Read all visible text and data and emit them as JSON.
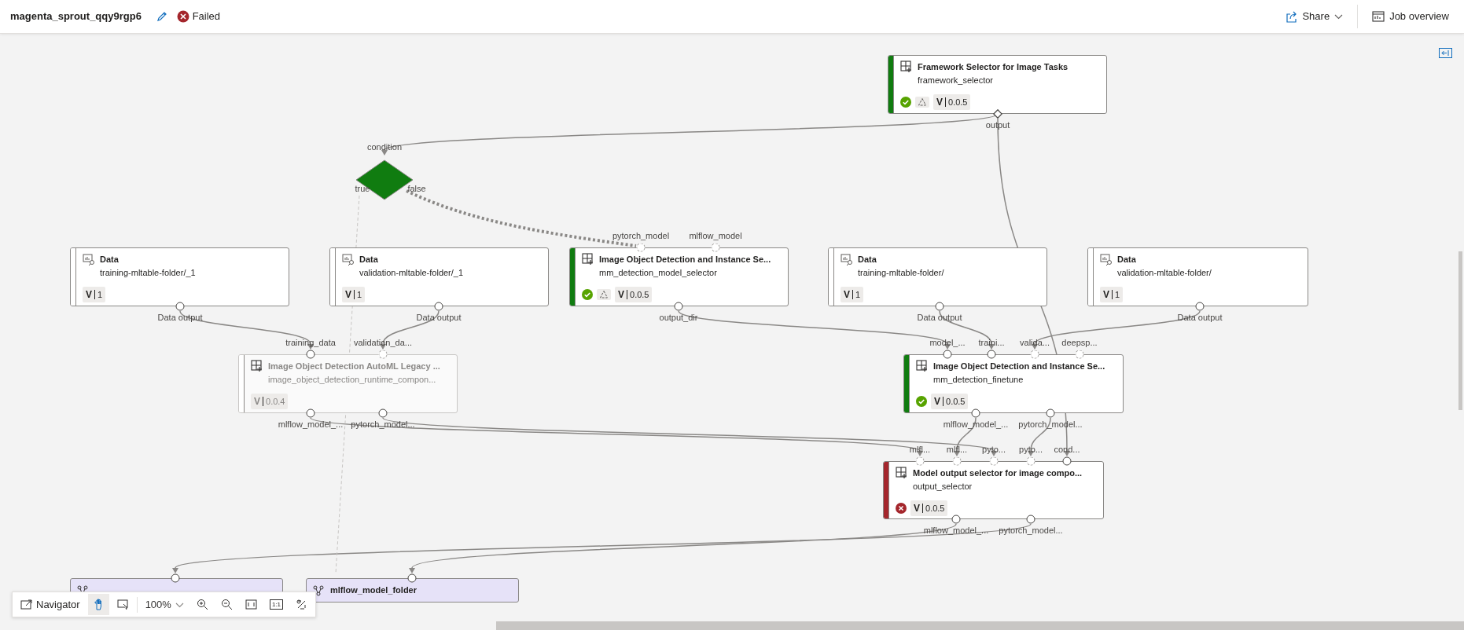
{
  "header": {
    "title": "magenta_sprout_qqy9rgp6",
    "status": "Failed",
    "share": "Share",
    "job_overview": "Job overview"
  },
  "condition": {
    "input_label": "condition",
    "true_label": "true",
    "false_label": "false"
  },
  "nodes": [
    {
      "kind": "component",
      "title": "Framework Selector for Image Tasks",
      "subtitle": "framework_selector",
      "completed": true,
      "failed": false,
      "reused": true,
      "disabled": false,
      "version_label": "V",
      "version": "0.0.5",
      "outputs": [
        {
          "label": "output",
          "kind": "control",
          "optional": false
        }
      ]
    },
    {
      "kind": "data",
      "title": "Data",
      "subtitle": "training-mltable-folder/_1",
      "version_label": "V",
      "version": "1",
      "outputs": [
        {
          "label": "Data output",
          "kind": "data",
          "optional": false
        }
      ]
    },
    {
      "kind": "data",
      "title": "Data",
      "subtitle": "validation-mltable-folder/_1",
      "version_label": "V",
      "version": "1",
      "outputs": [
        {
          "label": "Data output",
          "kind": "data",
          "optional": false
        }
      ]
    },
    {
      "kind": "component",
      "title": "Image Object Detection and Instance Se...",
      "subtitle": "mm_detection_model_selector",
      "completed": true,
      "failed": false,
      "reused": true,
      "disabled": false,
      "version_label": "V",
      "version": "0.0.5",
      "inputs": [
        {
          "label": "pytorch_model",
          "kind": "data",
          "optional": true
        },
        {
          "label": "mlflow_model",
          "kind": "data",
          "optional": true
        }
      ],
      "outputs": [
        {
          "label": "output_dir",
          "kind": "data",
          "optional": false
        }
      ]
    },
    {
      "kind": "data",
      "title": "Data",
      "subtitle": "training-mltable-folder/",
      "version_label": "V",
      "version": "1",
      "outputs": [
        {
          "label": "Data output",
          "kind": "data",
          "optional": false
        }
      ]
    },
    {
      "kind": "data",
      "title": "Data",
      "subtitle": "validation-mltable-folder/",
      "version_label": "V",
      "version": "1",
      "outputs": [
        {
          "label": "Data output",
          "kind": "data",
          "optional": false
        }
      ]
    },
    {
      "kind": "component",
      "title": "Image Object Detection AutoML Legacy ...",
      "subtitle": "image_object_detection_runtime_compon...",
      "completed": false,
      "failed": false,
      "reused": false,
      "disabled": true,
      "version_label": "V",
      "version": "0.0.4",
      "inputs": [
        {
          "label": "training_data",
          "kind": "data",
          "optional": false
        },
        {
          "label": "validation_da...",
          "kind": "data",
          "optional": true
        }
      ],
      "outputs": [
        {
          "label": "mlflow_model_...",
          "kind": "data",
          "optional": false
        },
        {
          "label": "pytorch_model...",
          "kind": "data",
          "optional": false
        }
      ]
    },
    {
      "kind": "component",
      "title": "Image Object Detection and Instance Se...",
      "subtitle": "mm_detection_finetune",
      "completed": true,
      "failed": false,
      "reused": false,
      "disabled": false,
      "version_label": "V",
      "version": "0.0.5",
      "inputs": [
        {
          "label": "model_...",
          "kind": "data",
          "optional": false
        },
        {
          "label": "traini...",
          "kind": "data",
          "optional": false
        },
        {
          "label": "valida...",
          "kind": "data",
          "optional": true
        },
        {
          "label": "deepsp...",
          "kind": "data",
          "optional": true
        }
      ],
      "outputs": [
        {
          "label": "mlflow_model_...",
          "kind": "data",
          "optional": false
        },
        {
          "label": "pytorch_model...",
          "kind": "data",
          "optional": false
        }
      ]
    },
    {
      "kind": "component",
      "title": "Model output selector for image compo...",
      "subtitle": "output_selector",
      "completed": false,
      "failed": true,
      "reused": false,
      "disabled": false,
      "version_label": "V",
      "version": "0.0.5",
      "inputs": [
        {
          "label": "mlfl...",
          "kind": "data",
          "optional": true
        },
        {
          "label": "mlfl...",
          "kind": "data",
          "optional": true
        },
        {
          "label": "pyto...",
          "kind": "data",
          "optional": true
        },
        {
          "label": "pyto...",
          "kind": "data",
          "optional": true
        },
        {
          "label": "cond...",
          "kind": "data",
          "optional": false
        }
      ],
      "outputs": [
        {
          "label": "mlflow_model_...",
          "kind": "data",
          "optional": false
        },
        {
          "label": "pytorch_model...",
          "kind": "data",
          "optional": false
        }
      ]
    },
    {
      "kind": "output",
      "inputs": [
        {
          "kind": "data",
          "optional": false
        }
      ]
    },
    {
      "kind": "output",
      "title": "mlflow_model_folder",
      "inputs": [
        {
          "kind": "data",
          "optional": false
        }
      ]
    }
  ],
  "navigator": {
    "label": "Navigator",
    "tools": [
      {
        "selected": true
      },
      {
        "selected": false
      }
    ],
    "zoom": "100%",
    "actual_size": "1:1"
  }
}
